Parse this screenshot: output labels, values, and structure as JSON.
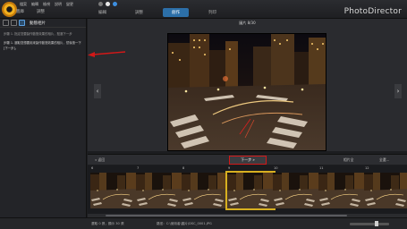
{
  "app": {
    "brand": "PhotoDirector"
  },
  "menu": [
    "檔案",
    "編輯",
    "檢視",
    "說明",
    "變更"
  ],
  "mode_tabs": [
    {
      "label": "編輯",
      "active": false
    },
    {
      "label": "調整",
      "active": false
    },
    {
      "label": "創作",
      "active": true
    },
    {
      "label": "列印",
      "active": false
    }
  ],
  "category_tabs": [
    "圖庫",
    "調整"
  ],
  "panel": {
    "title": "動態相片",
    "note": "步驟 1. 指定您要製作動態效果的相片，點選下一步",
    "hint": "步驟 1. 選取您想要用來製作動態效果的相片，然後按一下 [下一步]。"
  },
  "viewer": {
    "file_info": "圖片 8/30",
    "prev": "‹",
    "next": "›"
  },
  "wizard": {
    "back": "« 返回",
    "next": "下一步 »",
    "right_a": "相片全",
    "right_b": "全選..."
  },
  "filmstrip": [
    {
      "num": "6",
      "selected": false
    },
    {
      "num": "7",
      "selected": false
    },
    {
      "num": "8",
      "selected": false
    },
    {
      "num": "9",
      "selected": true
    },
    {
      "num": "10",
      "selected": false
    },
    {
      "num": "11",
      "selected": false
    },
    {
      "num": "12",
      "selected": false
    }
  ],
  "status": {
    "left": "選取 0 張，顯示 30 張",
    "mid": "路徑：C:\\使用者\\圖片\\DSC_0001.JPG"
  },
  "colors": {
    "accent": "#2c6fa8",
    "highlight": "#d8b020",
    "annotation": "#d21818"
  }
}
